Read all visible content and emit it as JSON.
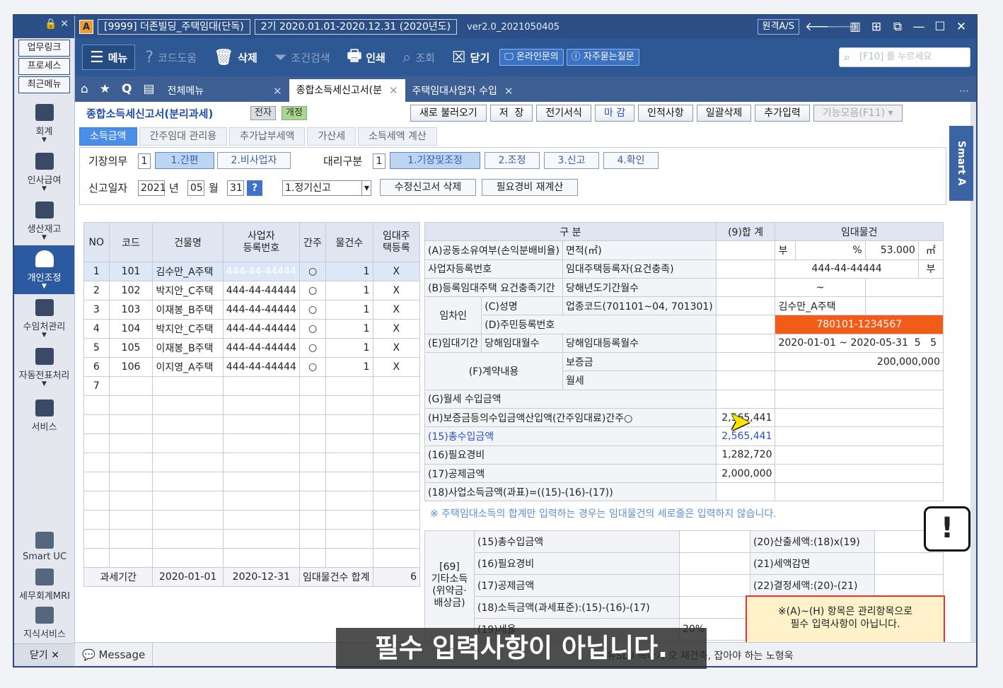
{
  "titlebar": {
    "logo": "A",
    "company": "[9999] 더존빌딩_주택임대(단독)",
    "period": "2기 2020.01.01-2020.12.31 (2020년도)",
    "version": "ver2.0_2021050405",
    "remote": "원격A/S"
  },
  "sidebar": {
    "links": [
      "업무링크",
      "프로세스",
      "최근메뉴"
    ],
    "items": [
      {
        "label": "회계",
        "icon": "calculator-icon"
      },
      {
        "label": "인사급여",
        "icon": "person-icon"
      },
      {
        "label": "생산재고",
        "icon": "grid-icon"
      },
      {
        "label": "개인조정",
        "icon": "user-icon"
      },
      {
        "label": "수임처관리",
        "icon": "client-icon"
      },
      {
        "label": "자동전표처리",
        "icon": "document-stack-icon"
      },
      {
        "label": "서비스",
        "icon": "monitor-icon"
      }
    ],
    "bottom": [
      {
        "label": "Smart UC",
        "icon": "uc-icon"
      },
      {
        "label": "세무회계MRI",
        "icon": "pulse-icon"
      },
      {
        "label": "지식서비스",
        "icon": "book-icon"
      }
    ],
    "close": "닫기"
  },
  "toolbar": {
    "menu": "메뉴",
    "help": "코드도움",
    "delete": "삭제",
    "filter": "조건검색",
    "print": "인쇄",
    "lookup": "조회",
    "close": "닫기",
    "online": "온라인문의",
    "faq": "자주묻는질문",
    "search_placeholder": "[F10] 를 누르세요"
  },
  "tabs": {
    "all_menu": "전체메뉴",
    "open": [
      {
        "label": "종합소득세신고서(분",
        "active": true
      },
      {
        "label": "주택임대사업자 수입",
        "active": false
      }
    ]
  },
  "page": {
    "title": "종합소득세신고서(분리과세)",
    "badge1": "전자",
    "badge2": "개정",
    "actions": [
      "새로 불러오기",
      "저  장",
      "전기서식",
      "마 감",
      "인적사항",
      "일괄삭제",
      "추가입력",
      "기능모음(F11)"
    ],
    "subtabs": [
      "소득금액",
      "간주임대 관리용",
      "추가납부세액",
      "가산세",
      "소득세액 계산"
    ],
    "bookkeeping_label": "기장의무",
    "bookkeeping_val": "1",
    "bk_options": [
      "1.간편",
      "2.비사업자"
    ],
    "agent_label": "대리구분",
    "agent_val": "1",
    "agent_options": [
      "1.기장및조정",
      "2.조정",
      "3.신고",
      "4.확인"
    ],
    "date_label": "신고일자",
    "year": "2021",
    "year_unit": "년",
    "month": "05",
    "month_unit": "월",
    "day": "31",
    "help_btn": "?",
    "report_type": "1.정기신고",
    "btn_amend_delete": "수정신고서 삭제",
    "btn_recalc": "필요경비 재계산"
  },
  "left_table": {
    "headers": [
      "NO",
      "코드",
      "건물명",
      "사업자\n등록번호",
      "간주",
      "물건수",
      "임대주\n택등록"
    ],
    "rows": [
      [
        "1",
        "101",
        "김수만_A주택",
        "444-44-44444",
        "○",
        "1",
        "X"
      ],
      [
        "2",
        "102",
        "박지안_C주택",
        "444-44-44444",
        "○",
        "1",
        "X"
      ],
      [
        "3",
        "103",
        "이재봉_B주택",
        "444-44-44444",
        "○",
        "1",
        "X"
      ],
      [
        "4",
        "104",
        "박지안_C주택",
        "444-44-44444",
        "○",
        "1",
        "X"
      ],
      [
        "5",
        "105",
        "이재봉_B주택",
        "444-44-44444",
        "○",
        "1",
        "X"
      ],
      [
        "6",
        "106",
        "이지영_A주택",
        "444-44-44444",
        "○",
        "1",
        "X"
      ],
      [
        "7",
        "",
        "",
        "",
        "",
        "",
        ""
      ]
    ],
    "footer_label": "과세기간",
    "footer_from": "2020-01-01",
    "footer_to": "2020-12-31",
    "footer_count_label": "임대물건수 합계",
    "footer_count": "6"
  },
  "right_table": {
    "h_gubun": "구 분",
    "h_total": "(9)합 계",
    "h_property": "임대물건",
    "r_a": "(A)공동소유여부(손익분배비율)",
    "r_a_area": "면적(㎡)",
    "r_a_yn": "부",
    "r_a_pct": "%",
    "r_a_area_val": "53.000",
    "r_a_unit": "㎡",
    "r_biz": "사업자등록번호",
    "r_biz_reg": "임대주택등록자(요건충족)",
    "r_biz_val": "444-44-44444",
    "r_biz_yn": "부",
    "r_b": "(B)등록임대주택 요건충족기간",
    "r_b_months": "당해년도기간월수",
    "r_b_tilde": "~",
    "r_tenant": "임차인",
    "r_c": "(C)성명",
    "r_c_code": "업종코드(701101~04, 701301)",
    "r_c_val": "김수만_A주택",
    "r_d": "(D)주민등록번호",
    "r_d_val": "780101-1234567",
    "r_e": "(E)임대기간",
    "r_e_m1": "당해임대월수",
    "r_e_m2": "당해임대등록월수",
    "r_e_from": "2020-01-01",
    "r_e_tilde": "~",
    "r_e_to": "2020-05-31",
    "r_e_v1": "5",
    "r_e_v2": "5",
    "r_f": "(F)계약내용",
    "r_f_dep": "보증금",
    "r_f_dep_val": "200,000,000",
    "r_f_mon": "월세",
    "r_g": "(G)월세 수입금액",
    "r_h": "(H)보증금등의수입금액산입액(간주임대료)간주○",
    "r_h_val": "2,565,441",
    "r_15": "(15)총수입금액",
    "r_15_val": "2,565,441",
    "r_16": "(16)필요경비",
    "r_16_val": "1,282,720",
    "r_17": "(17)공제금액",
    "r_17_val": "2,000,000",
    "r_18": "(18)사업소득금액(과표)=((15)-(16)-(17))"
  },
  "notice": "※ 주택임대소득의 합계만 입력하는 경우는 임대물건의 세로줄은 입력하지 않습니다.",
  "bottom_table": {
    "group": "[69]\n기타소득\n(위약금·\n배상금)",
    "rows": [
      {
        "label": "(15)총수입금액",
        "right": "(20)산출세액:(18)x(19)"
      },
      {
        "label": "(16)필요경비",
        "right": "(21)세액감면"
      },
      {
        "label": "(17)공제금액",
        "right": "(22)결정세액:(20)-(21)"
      },
      {
        "label": "(18)소득금액(과세표준):(15)-(16)-(17)",
        "right": ""
      },
      {
        "label": "(19)세율",
        "value": "20%",
        "right": ""
      }
    ]
  },
  "red_note": "※(A)~(H) 항목은 관리항목으로\n필수 입력사항이 아닙니다.",
  "smart_panel": "Smart A",
  "bubble": "!",
  "statusbar": {
    "message": "Message",
    "ticker": "유SLU 속다가 오 재건축, 잡아야 하는 노형욱"
  },
  "subtitle": "필수 입력사항이 아닙니다."
}
